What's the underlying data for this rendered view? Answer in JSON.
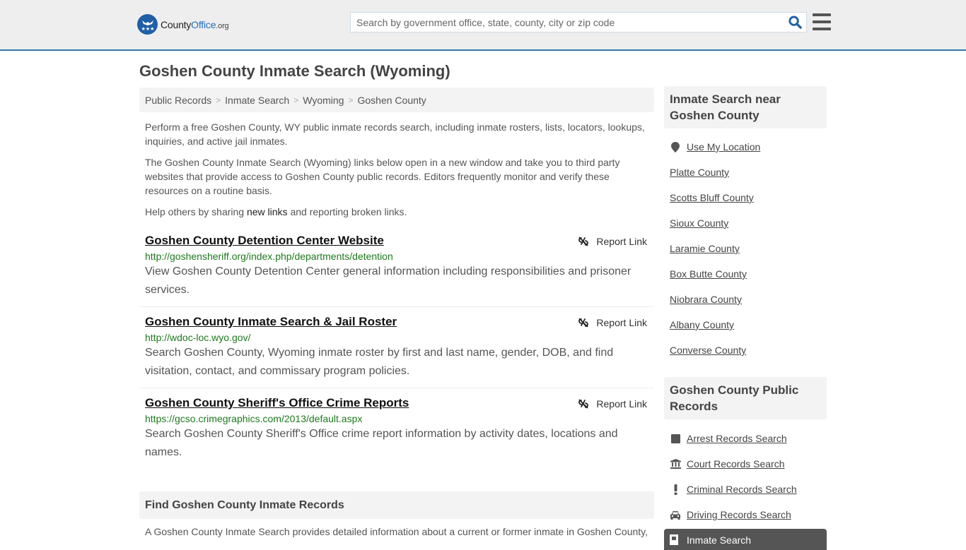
{
  "header": {
    "logo": {
      "brand_part1": "County",
      "brand_part2": "Office",
      "brand_suffix": ".org",
      "brand_color": "#1f5fa6"
    },
    "search": {
      "placeholder": "Search by government office, state, county, city or zip code",
      "value": ""
    },
    "icons": {
      "search": "search-icon",
      "menu": "hamburger-menu-icon"
    }
  },
  "page": {
    "title": "Goshen County Inmate Search (Wyoming)"
  },
  "breadcrumb": [
    {
      "label": "Public Records"
    },
    {
      "label": "Inmate Search"
    },
    {
      "label": "Wyoming"
    },
    {
      "label": "Goshen County"
    }
  ],
  "intro": {
    "p1": "Perform a free Goshen County, WY public inmate records search, including inmate rosters, lists, locators, lookups, inquiries, and active jail inmates.",
    "p2": "The Goshen County Inmate Search (Wyoming) links below open in a new window and take you to third party websites that provide access to Goshen County public records. Editors frequently monitor and verify these resources on a routine basis.",
    "p3_before": "Help others by sharing ",
    "p3_link": "new links",
    "p3_after": " and reporting broken links."
  },
  "links": [
    {
      "title": "Goshen County Detention Center Website",
      "url": "http://goshensheriff.org/index.php/departments/detention",
      "description": "View Goshen County Detention Center general information including responsibilities and prisoner services.",
      "report_label": "Report Link"
    },
    {
      "title": "Goshen County Inmate Search & Jail Roster",
      "url": "http://wdoc-loc.wyo.gov/",
      "description": "Search Goshen County, Wyoming inmate roster by first and last name, gender, DOB, and find visitation, contact, and commissary program policies.",
      "report_label": "Report Link"
    },
    {
      "title": "Goshen County Sheriff's Office Crime Reports",
      "url": "https://gcso.crimegraphics.com/2013/default.aspx",
      "description": "Search Goshen County Sheriff's Office crime report information by activity dates, locations and names.",
      "report_label": "Report Link"
    }
  ],
  "find_section": {
    "heading": "Find Goshen County Inmate Records",
    "body": "A Goshen County Inmate Search provides detailed information about a current or former inmate in Goshen County,"
  },
  "sidebar": {
    "nearby": {
      "heading": "Inmate Search near Goshen County",
      "use_location": "Use My Location",
      "items": [
        {
          "label": "Platte County"
        },
        {
          "label": "Scotts Bluff County"
        },
        {
          "label": "Sioux County"
        },
        {
          "label": "Laramie County"
        },
        {
          "label": "Box Butte County"
        },
        {
          "label": "Niobrara County"
        },
        {
          "label": "Albany County"
        },
        {
          "label": "Converse County"
        }
      ]
    },
    "records": {
      "heading": "Goshen County Public Records",
      "items": [
        {
          "label": "Arrest Records Search",
          "icon": "arrest-icon"
        },
        {
          "label": "Court Records Search",
          "icon": "courthouse-icon"
        },
        {
          "label": "Criminal Records Search",
          "icon": "exclamation-icon"
        },
        {
          "label": "Driving Records Search",
          "icon": "car-icon"
        }
      ],
      "active_item": {
        "label": "Inmate Search",
        "icon": "jail-door-icon"
      }
    }
  },
  "colors": {
    "accent_blue": "#3476ad",
    "url_green": "#1e7a1e",
    "active_bg": "#555555"
  }
}
